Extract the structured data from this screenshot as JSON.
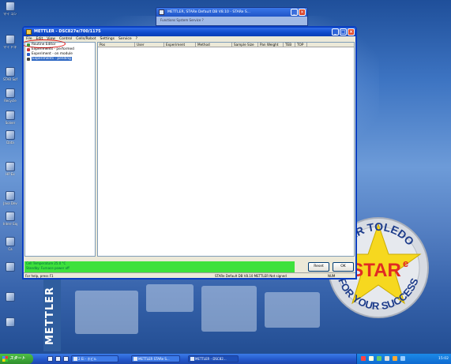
{
  "desktop": {
    "icons": [
      {
        "label": "マイ コンピュータ",
        "icon": "my-computer-icon"
      },
      {
        "label": "マイ ドキュメント",
        "icon": "my-documents-icon"
      },
      {
        "label": "STAR Softw",
        "icon": "star-software-icon"
      },
      {
        "label": "Recycle",
        "icon": "recycle-bin-icon"
      },
      {
        "label": "Solver",
        "icon": "solver-icon"
      },
      {
        "label": "Data",
        "icon": "data-icon"
      },
      {
        "label": "HP Ex",
        "icon": "hp-ex-icon"
      },
      {
        "label": "Java Dev",
        "icon": "java-icon"
      },
      {
        "label": "Interr Expl",
        "icon": "internet-explorer-icon"
      },
      {
        "label": "Ca",
        "icon": "calc-icon"
      },
      {
        "label": "",
        "icon": "shortcut-icon"
      },
      {
        "label": "",
        "icon": "shortcut-icon"
      },
      {
        "label": "",
        "icon": "shortcut-icon"
      }
    ]
  },
  "mini_window": {
    "title": "METTLER, STARe Default DB V8.10 - STARe S...",
    "menu": "Functions   System   Service   ?"
  },
  "main_window": {
    "title": "METTLER - DSC827e/700/1175",
    "menu": [
      "File",
      "Edit",
      "View",
      "Control",
      "Cells/Robot",
      "Settings",
      "Service",
      "?"
    ],
    "tree": [
      {
        "label": "Routine Editor",
        "selected": false
      },
      {
        "label": "Experiments - performed",
        "selected": false
      },
      {
        "label": "Experiment - on module",
        "selected": false
      },
      {
        "label": "Experiments - pending",
        "selected": true
      }
    ],
    "columns": [
      "Pos",
      "User",
      "Experiment",
      "Method",
      "Sample Size",
      "Pan Weight",
      "TEB",
      "TOP"
    ],
    "status_green_line1": "Cell Temperature 25.0  °C",
    "status_green_line2": "Standby: Furnace power off",
    "reset_label": "Reset",
    "ok_label": "OK",
    "statusbar_help": "For help, press F1",
    "statusbar_db": "STARe Default DB V8.10 METTLER Not signed",
    "statusbar_num": "NUM"
  },
  "branding": {
    "mettler": "METTLER",
    "badge_top": "LER TOLEDO",
    "badge_mid": "STAR",
    "badge_sup": "e",
    "badge_bottom": "FOR YOUR SUCCESS",
    "badge_colors": {
      "blue": "#1c3b8a",
      "yellow": "#f6d81f",
      "red": "#e12a23",
      "silver": "#d7dbe2"
    }
  },
  "taskbar": {
    "start": "スタート",
    "tasks": [
      "2 Ei - ホビル",
      "METTLER STARe S...",
      "METTLER - DSC82..."
    ],
    "clock": "15:02"
  }
}
